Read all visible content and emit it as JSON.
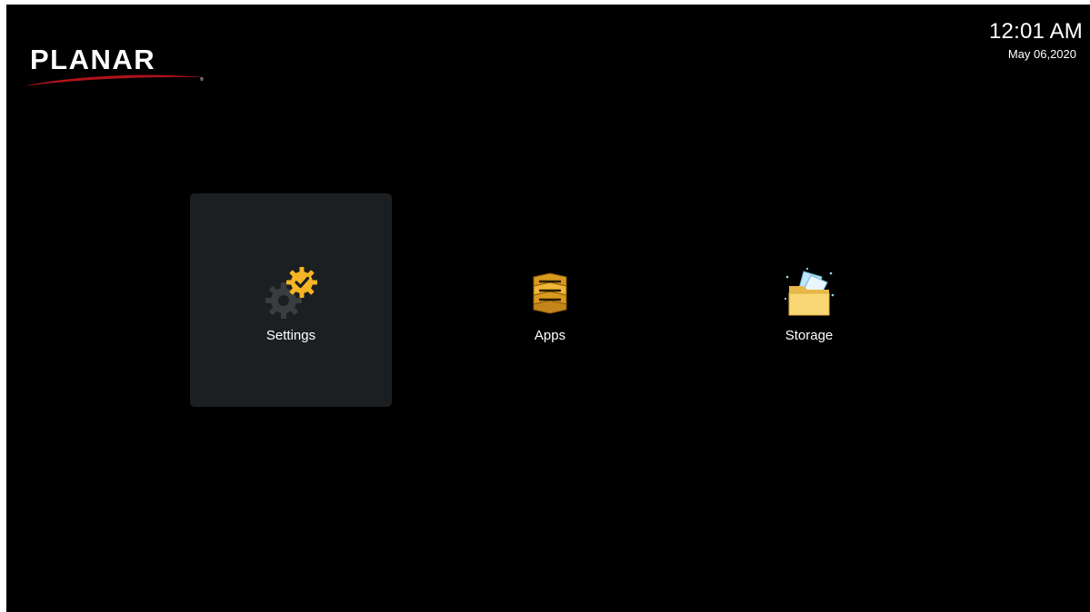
{
  "brand": {
    "name": "PLANAR",
    "registered_mark": "®",
    "colors": {
      "text": "#ffffff",
      "swoosh": "#b0121b"
    }
  },
  "clock": {
    "time": "12:01 AM",
    "date": "May 06,2020"
  },
  "tiles": [
    {
      "label": "Settings",
      "icon": "gear-check-icon",
      "focused": true
    },
    {
      "label": "Apps",
      "icon": "apps-stack-icon",
      "focused": false
    },
    {
      "label": "Storage",
      "icon": "folder-icon",
      "focused": false
    }
  ],
  "colors": {
    "background": "#000000",
    "focused_tile": "#1c1f21",
    "accent_gold": "#f5b524",
    "folder_yellow": "#f9d774"
  }
}
